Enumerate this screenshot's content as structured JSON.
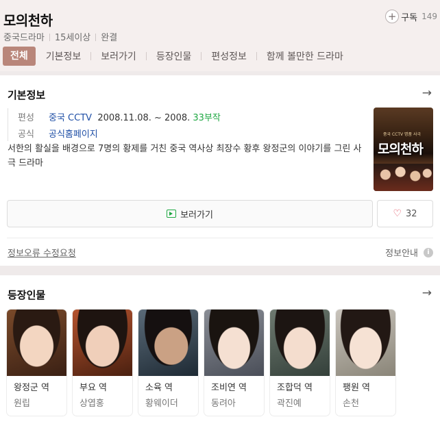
{
  "header": {
    "title": "모의천하",
    "meta": [
      "중국드라마",
      "15세이상",
      "완결"
    ],
    "subscribe": {
      "label": "구독",
      "count": "149"
    },
    "tabs": [
      {
        "label": "전체",
        "active": true
      },
      {
        "label": "기본정보",
        "active": false
      },
      {
        "label": "보러가기",
        "active": false
      },
      {
        "label": "등장인물",
        "active": false
      },
      {
        "label": "편성정보",
        "active": false
      },
      {
        "label": "함께 볼만한 드라마",
        "active": false
      }
    ]
  },
  "info": {
    "section_title": "기본정보",
    "schedule_label": "편성",
    "channel": "중국 CCTV",
    "period": "2008.11.08. ~ 2008.",
    "episodes": "33부작",
    "official_label": "공식",
    "official_link": "공식홈페이지",
    "description": "서한의 활실을 배경으로 7명의 황제를 거친 중국 역사상 최장수 황후 왕정군의 이야기를 그린 사극 드라마",
    "poster_title": "모의천하",
    "poster_sub": "중국 CCTV 명품 사극",
    "watch_label": "보러가기",
    "like_count": "32",
    "report_label": "정보오류 수정요청",
    "guide_label": "정보안내"
  },
  "cast": {
    "section_title": "등장인물",
    "members": [
      {
        "role": "왕정군 역",
        "actor": "원립"
      },
      {
        "role": "부요 역",
        "actor": "상엽홍"
      },
      {
        "role": "소육 역",
        "actor": "황웨이더"
      },
      {
        "role": "조비연 역",
        "actor": "동려아"
      },
      {
        "role": "조합덕 역",
        "actor": "곽진예"
      },
      {
        "role": "팽원 역",
        "actor": "손천"
      }
    ]
  },
  "colors": {
    "accent_tab": "#b9867a",
    "link": "#1f4fa6",
    "episodes": "#1fa843",
    "heart": "#e0485a"
  }
}
